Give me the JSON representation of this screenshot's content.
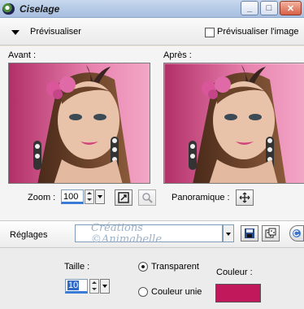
{
  "window": {
    "title": "Ciselage"
  },
  "titlebar": {
    "minimize": "_",
    "maximize": "□",
    "close": "✕"
  },
  "preview": {
    "label": "Prévisualiser",
    "preview_image_label": "Prévisualiser l'image",
    "preview_image_checked": false
  },
  "images": {
    "before_label": "Avant :",
    "after_label": "Après :"
  },
  "zoom": {
    "label": "Zoom :",
    "value": "100"
  },
  "pan": {
    "label": "Panoramique :"
  },
  "settings": {
    "label": "Réglages",
    "preset_value": ""
  },
  "watermark": {
    "line1": "Créations",
    "line2": "©Animabelle"
  },
  "size": {
    "label": "Taille :",
    "value": "10"
  },
  "options": {
    "transparent": "Transparent",
    "solid_color": "Couleur unie",
    "selected": "transparent"
  },
  "color": {
    "label": "Couleur :",
    "value": "#c0185a"
  },
  "icons": {
    "app": "app-icon",
    "preview_toggle": "triangle-down-icon",
    "fit": "fit-window-icon",
    "zoom_lens": "zoom-lens-icon",
    "pan": "pan-arrows-icon",
    "save": "save-icon",
    "random": "dice-icon",
    "reset": "reset-icon"
  }
}
